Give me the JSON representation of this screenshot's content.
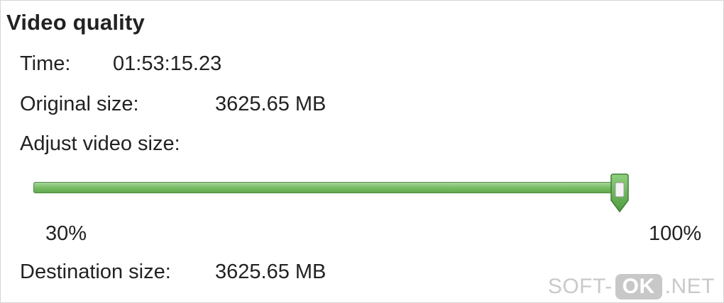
{
  "section": {
    "title": "Video quality"
  },
  "time": {
    "label": "Time:",
    "value": "01:53:15.23"
  },
  "original_size": {
    "label": "Original size:",
    "value": "3625.65 MB"
  },
  "adjust": {
    "label": "Adjust video size:",
    "slider": {
      "min_label": "30%",
      "max_label": "100%",
      "min": 30,
      "max": 100,
      "value": 100,
      "fill_color": "#6db25c"
    }
  },
  "destination_size": {
    "label": "Destination size:",
    "value": "3625.65 MB"
  },
  "watermark": {
    "prefix": "SOFT-",
    "badge": "OK",
    "suffix": ".NET"
  }
}
